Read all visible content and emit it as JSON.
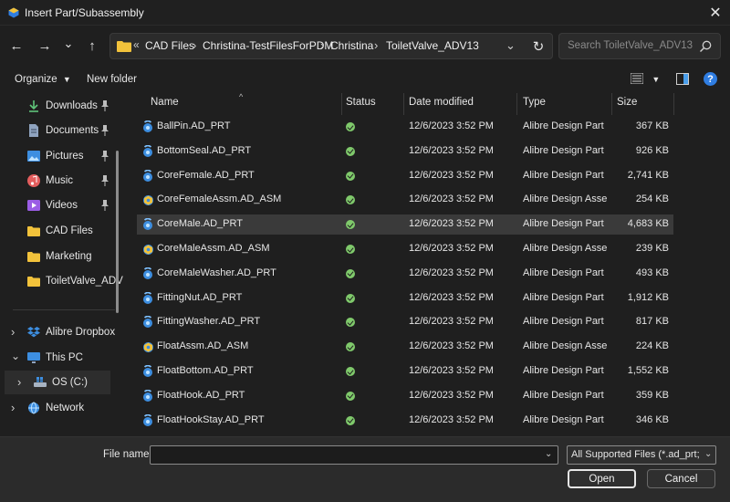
{
  "window": {
    "title": "Insert Part/Subassembly"
  },
  "nav": {
    "back": "←",
    "forward": "→",
    "recent": "⌄",
    "up": "↑",
    "path": [
      "CAD Files",
      "Christina-TestFilesForPDM",
      "Christina",
      "ToiletValve_ADV13"
    ],
    "overflow": "«",
    "search_placeholder": "Search ToiletValve_ADV13"
  },
  "toolbar": {
    "organize": "Organize",
    "new_folder": "New folder"
  },
  "sidebar": {
    "quick": [
      {
        "label": "Downloads",
        "icon": "download-icon",
        "pinned": true
      },
      {
        "label": "Documents",
        "icon": "document-icon",
        "pinned": true
      },
      {
        "label": "Pictures",
        "icon": "pictures-icon",
        "pinned": true
      },
      {
        "label": "Music",
        "icon": "music-icon",
        "pinned": true
      },
      {
        "label": "Videos",
        "icon": "videos-icon",
        "pinned": true
      },
      {
        "label": "CAD Files",
        "icon": "folder-icon",
        "pinned": false
      },
      {
        "label": "Marketing",
        "icon": "folder-icon",
        "pinned": false
      },
      {
        "label": "ToiletValve_ADV",
        "icon": "folder-icon",
        "pinned": false
      }
    ],
    "tree": [
      {
        "label": "Alibre Dropbox",
        "icon": "dropbox-icon"
      },
      {
        "label": "This PC",
        "icon": "pc-icon"
      },
      {
        "label": "OS (C:)",
        "icon": "drive-icon"
      },
      {
        "label": "Network",
        "icon": "network-icon"
      }
    ]
  },
  "columns": {
    "name": "Name",
    "status": "Status",
    "date": "Date modified",
    "type": "Type",
    "size": "Size"
  },
  "files": [
    {
      "name": "BallPin.AD_PRT",
      "date": "12/6/2023 3:52 PM",
      "type": "Alibre Design Part",
      "size": "367 KB",
      "kind": "part"
    },
    {
      "name": "BottomSeal.AD_PRT",
      "date": "12/6/2023 3:52 PM",
      "type": "Alibre Design Part",
      "size": "926 KB",
      "kind": "part"
    },
    {
      "name": "CoreFemale.AD_PRT",
      "date": "12/6/2023 3:52 PM",
      "type": "Alibre Design Part",
      "size": "2,741 KB",
      "kind": "part"
    },
    {
      "name": "CoreFemaleAssm.AD_ASM",
      "date": "12/6/2023 3:52 PM",
      "type": "Alibre Design Asse...",
      "size": "254 KB",
      "kind": "asm"
    },
    {
      "name": "CoreMale.AD_PRT",
      "date": "12/6/2023 3:52 PM",
      "type": "Alibre Design Part",
      "size": "4,683 KB",
      "kind": "part"
    },
    {
      "name": "CoreMaleAssm.AD_ASM",
      "date": "12/6/2023 3:52 PM",
      "type": "Alibre Design Asse...",
      "size": "239 KB",
      "kind": "asm"
    },
    {
      "name": "CoreMaleWasher.AD_PRT",
      "date": "12/6/2023 3:52 PM",
      "type": "Alibre Design Part",
      "size": "493 KB",
      "kind": "part"
    },
    {
      "name": "FittingNut.AD_PRT",
      "date": "12/6/2023 3:52 PM",
      "type": "Alibre Design Part",
      "size": "1,912 KB",
      "kind": "part"
    },
    {
      "name": "FittingWasher.AD_PRT",
      "date": "12/6/2023 3:52 PM",
      "type": "Alibre Design Part",
      "size": "817 KB",
      "kind": "part"
    },
    {
      "name": "FloatAssm.AD_ASM",
      "date": "12/6/2023 3:52 PM",
      "type": "Alibre Design Asse...",
      "size": "224 KB",
      "kind": "asm"
    },
    {
      "name": "FloatBottom.AD_PRT",
      "date": "12/6/2023 3:52 PM",
      "type": "Alibre Design Part",
      "size": "1,552 KB",
      "kind": "part"
    },
    {
      "name": "FloatHook.AD_PRT",
      "date": "12/6/2023 3:52 PM",
      "type": "Alibre Design Part",
      "size": "359 KB",
      "kind": "part"
    },
    {
      "name": "FloatHookStay.AD_PRT",
      "date": "12/6/2023 3:52 PM",
      "type": "Alibre Design Part",
      "size": "346 KB",
      "kind": "part"
    }
  ],
  "selected_file": "CoreMale.AD_PRT",
  "footer": {
    "file_name_label": "File name:",
    "file_name_value": "",
    "filter": "All Supported Files (*.ad_prt; *.ad_asm)",
    "open": "Open",
    "cancel": "Cancel"
  },
  "colors": {
    "accent": "#4a9eea",
    "status_ok": "#7fc96b",
    "folder": "#f2c23b"
  }
}
